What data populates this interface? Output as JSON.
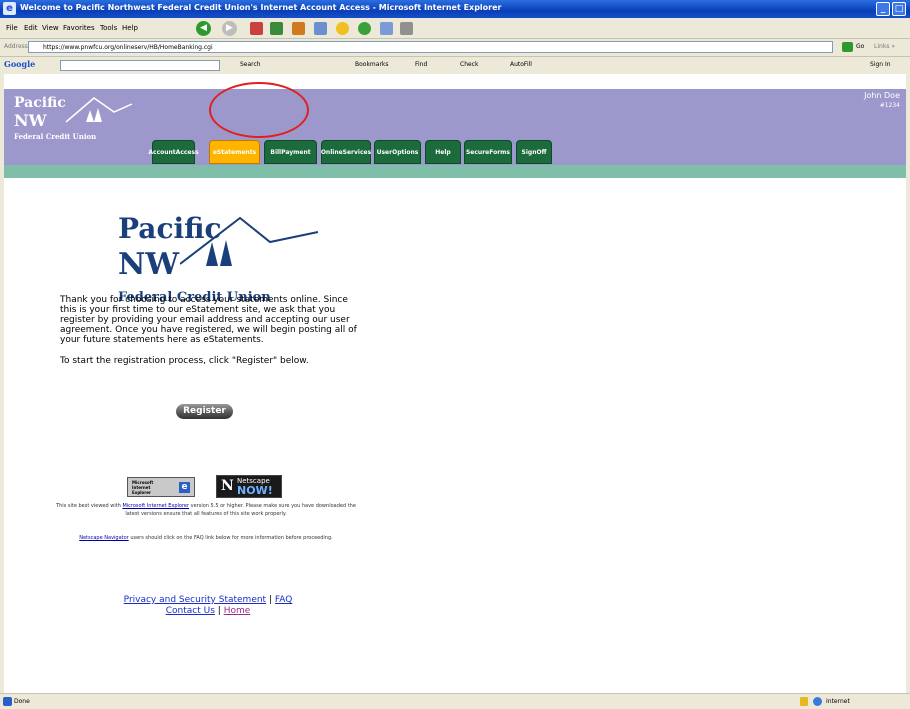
{
  "window": {
    "title": "Welcome to Pacific Northwest Federal Credit Union's Internet Account Access - Microsoft Internet Explorer",
    "ie_logo": "e",
    "controls": {
      "minimize": "_",
      "maximize": "□"
    }
  },
  "menu": [
    "File",
    "Edit",
    "View",
    "Favorites",
    "Tools",
    "Help"
  ],
  "address": {
    "label": "Address",
    "url": "https://www.pnwfcu.org/onlineserv/HB/HomeBanking.cgi",
    "go": "Go",
    "links": "Links »"
  },
  "googlebar": {
    "logo": "Google",
    "search": "Search",
    "bookmarks": "Bookmarks",
    "find": "Find",
    "check": "Check",
    "autofill": "AutoFill",
    "signin": "Sign In"
  },
  "banner": {
    "logo_line1": "Pacific",
    "logo_line2": "NW",
    "logo_line3": "Federal Credit Union",
    "user_name": "John Doe",
    "user_account": "#1234"
  },
  "nav_tabs": [
    {
      "line1": "Account",
      "line2": "Access",
      "active": false
    },
    {
      "line1": "eStatements",
      "line2": "",
      "active": true
    },
    {
      "line1": "Bill",
      "line2": "Payment",
      "active": false
    },
    {
      "line1": "Online",
      "line2": "Services",
      "active": false
    },
    {
      "line1": "User",
      "line2": "Options",
      "active": false
    },
    {
      "line1": "Help",
      "line2": "",
      "active": false
    },
    {
      "line1": "Secure",
      "line2": "Forms",
      "active": false
    },
    {
      "line1": "Sign",
      "line2": "Off",
      "active": false
    }
  ],
  "content": {
    "logo_line1": "Pacific",
    "logo_line2": "NW",
    "logo_line3": "Federal Credit Union",
    "intro": "Thank you for choosing to access your statements online. Since this is your first time to our eStatement site, we ask that you register by providing your email address and accepting our user agreement. Once you have registered, we will begin posting all of your future statements here as eStatements.",
    "instruction": "To start the registration process, click \"Register\" below.",
    "register_button": "Register",
    "ie_badge_line1": "Microsoft",
    "ie_badge_line2": "Internet",
    "ie_badge_line3": "Explorer",
    "ns_badge_line1": "Netscape",
    "ns_badge_line2": "NOW!",
    "browser_note_pre": "This site best viewed with ",
    "browser_note_link": "Microsoft Internet Explorer",
    "browser_note_post": " version 5.5 or higher. Please make sure you have downloaded the latest versions ensure that all features of this site work properly.",
    "netscape_note_link": "Netscape Navigator",
    "netscape_note_post": " users should click on the FAQ link below for more information before proceeding."
  },
  "footer": {
    "privacy": "Privacy and Security Statement",
    "faq": "FAQ",
    "contact": "Contact Us",
    "home": "Home",
    "separator": "|"
  },
  "status": {
    "text": "Done",
    "zone": "Internet"
  },
  "colors": {
    "banner": "#9c98cc",
    "strip": "#7fbfaa",
    "tab": "#1c6b3c",
    "tab_active": "#ffb400",
    "logo": "#1b3f7a",
    "highlight_circle": "#e02020"
  }
}
